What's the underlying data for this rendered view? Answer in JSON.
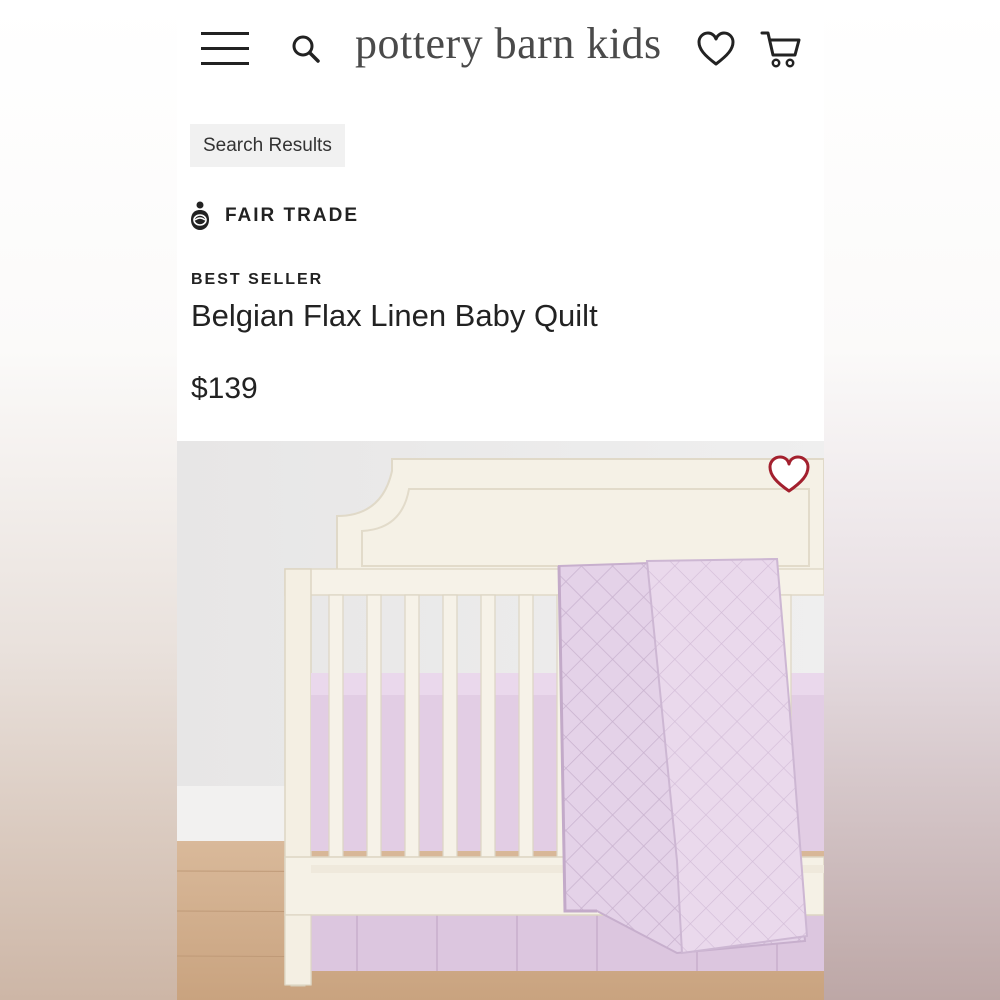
{
  "header": {
    "logo": "pottery barn kids",
    "icons": [
      "menu-icon",
      "search-icon",
      "heart-icon",
      "cart-icon"
    ]
  },
  "breadcrumb": {
    "label": "Search Results"
  },
  "product": {
    "fair_trade_label": "FAIR TRADE",
    "badge": "BEST SELLER",
    "title": "Belgian Flax Linen Baby Quilt",
    "price": "$139"
  },
  "colors": {
    "text": "#222222",
    "wishlist_heart": "#a3202e",
    "quilt": "#e3d0e6",
    "crib": "#f5f1e6"
  }
}
